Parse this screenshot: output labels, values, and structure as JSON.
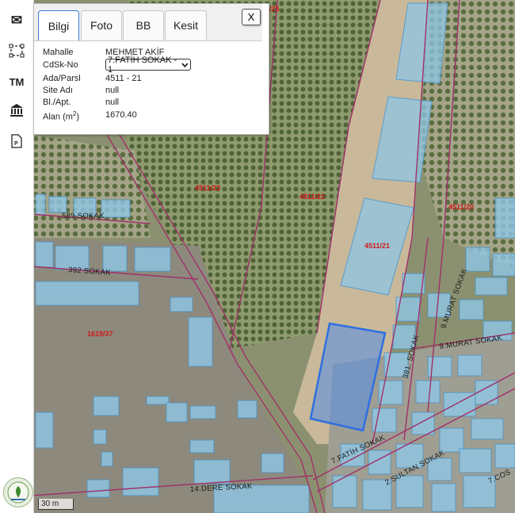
{
  "toolbar": {
    "tools": [
      {
        "name": "envelope-icon",
        "glyph": "✉"
      },
      {
        "name": "select-area-icon",
        "glyph": "⛶"
      },
      {
        "name": "tm-icon",
        "glyph": "TM"
      },
      {
        "name": "institution-icon",
        "glyph": "🏛"
      },
      {
        "name": "pdf-icon",
        "glyph": "🗎"
      }
    ]
  },
  "popup": {
    "tabs": [
      "Bilgi",
      "Foto",
      "BB",
      "Kesit"
    ],
    "active_tab": "Bilgi",
    "close_label": "X",
    "fields": {
      "mahalle_label": "Mahalle",
      "mahalle_value": "MEHMET AKİF",
      "cdsk_label": "CdSk-No",
      "cdsk_selected": "7.FATİH SOKAK - 1",
      "adaparsel_label": "Ada/Parsl",
      "adaparsel_value": "4511 - 21",
      "site_label": "Site Adı",
      "site_value": "null",
      "blapt_label": "Bl./Apt.",
      "blapt_value": "null",
      "alan_label": "Alan (m",
      "alan_sup": "2",
      "alan_label_end": ")",
      "alan_value": "1670.40"
    }
  },
  "map": {
    "parcel_labels": [
      "4511/23",
      "4511/22",
      "4511/20",
      "4511/21",
      "1619/37",
      "/25"
    ],
    "street_labels": [
      "589 SOKAK",
      "392 SOKAK",
      "9.MURAT SOKAK",
      "9.MURAT SOKAK",
      "381. SOKAK",
      "7.FATİH SOKAK",
      "2.SULTAN SOKAK",
      "14.DERE SOKAK",
      "7.COS"
    ],
    "parcel_color": "#d01818",
    "road_color": "#a0306a",
    "building_color": "#8ec7e6",
    "selection_color": "#2f6fe0"
  },
  "scale": {
    "label": "30 m"
  }
}
